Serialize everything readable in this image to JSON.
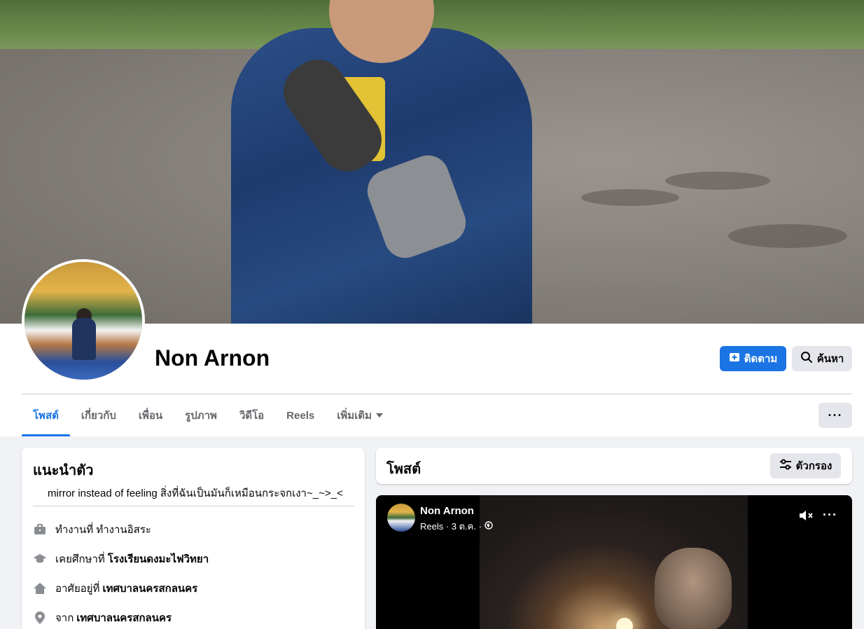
{
  "profile": {
    "name": "Non Arnon"
  },
  "actions": {
    "follow_label": "ติดตาม",
    "search_label": "ค้นหา",
    "more_label": "···"
  },
  "tabs": [
    {
      "label": "โพสต์",
      "active": true
    },
    {
      "label": "เกี่ยวกับ"
    },
    {
      "label": "เพื่อน"
    },
    {
      "label": "รูปภาพ"
    },
    {
      "label": "วิดีโอ"
    },
    {
      "label": "Reels"
    },
    {
      "label": "เพิ่มเติม"
    }
  ],
  "intro": {
    "title": "แนะนำตัว",
    "bio": "mirror instead of feeling สิ่งที่ฉันเป็นมันก็เหมือนกระจกเงา~_~>_<",
    "items": [
      {
        "icon": "briefcase-icon",
        "prefix": "ทำงานที่ ทำงานอิสระ",
        "value": ""
      },
      {
        "icon": "graduation-cap-icon",
        "prefix": "เคยศึกษาที่",
        "value": "โรงเรียนดงมะไฟวิทยา"
      },
      {
        "icon": "home-icon",
        "prefix": "อาศัยอยู่ที่",
        "value": "เทศบาลนครสกลนคร"
      },
      {
        "icon": "location-pin-icon",
        "prefix": "จาก",
        "value": "เทศบาลนครสกลนคร"
      }
    ]
  },
  "posts": {
    "title": "โพสต์",
    "filter_label": "ตัวกรอง",
    "reel": {
      "author": "Non Arnon",
      "meta": "Reels · 3 ต.ค. ·",
      "more_label": "···"
    }
  },
  "colors": {
    "accent": "#1b74e4",
    "button_grey": "#e4e6eb",
    "background": "#f0f2f5"
  }
}
